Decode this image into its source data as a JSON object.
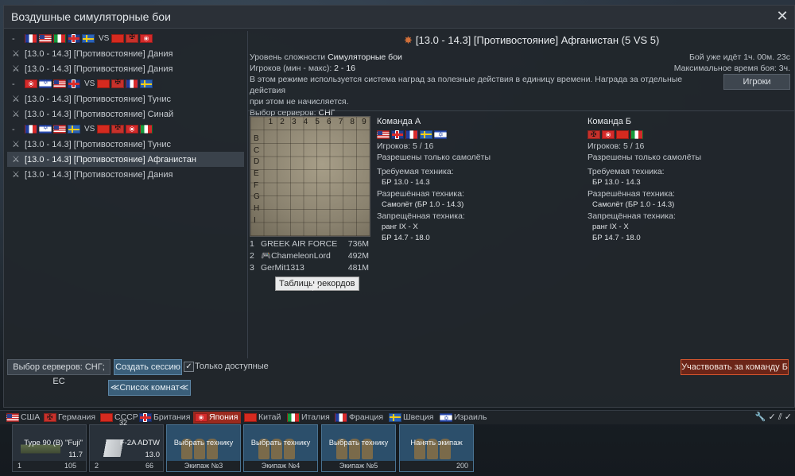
{
  "window": {
    "title": "Воздушные симуляторные бои"
  },
  "sessions": [
    {
      "kind": "header",
      "icon": "-",
      "flags_a": [
        "fr",
        "us",
        "it",
        "uk",
        "se"
      ],
      "vs": "VS",
      "flags_b": [
        "cn",
        "de",
        "jp"
      ]
    },
    {
      "kind": "mission",
      "label": "[13.0 - 14.3] [Противостояние] Дания",
      "selected": false
    },
    {
      "kind": "mission",
      "label": "[13.0 - 14.3] [Противостояние] Дания",
      "selected": false
    },
    {
      "kind": "header",
      "icon": "-",
      "flags_a": [
        "jp",
        "il",
        "us",
        "uk"
      ],
      "vs": "VS",
      "flags_b": [
        "cn",
        "de",
        "fr",
        "se"
      ]
    },
    {
      "kind": "mission",
      "label": "[13.0 - 14.3] [Противостояние] Тунис",
      "selected": false
    },
    {
      "kind": "mission",
      "label": "[13.0 - 14.3] [Противостояние] Синай",
      "selected": false
    },
    {
      "kind": "header",
      "icon": "-",
      "flags_a": [
        "fr",
        "il",
        "us",
        "se"
      ],
      "vs": "VS",
      "flags_b": [
        "cn",
        "de",
        "jp",
        "it"
      ]
    },
    {
      "kind": "mission",
      "label": "[13.0 - 14.3] [Противостояние] Тунис",
      "selected": false
    },
    {
      "kind": "mission",
      "label": "[13.0 - 14.3] [Противостояние] Афганистан",
      "selected": true
    },
    {
      "kind": "mission",
      "label": "[13.0 - 14.3] [Противостояние] Дания",
      "selected": false
    }
  ],
  "mission": {
    "title": "[13.0 - 14.3] [Противостояние] Афганистан (5 VS 5)",
    "difficulty_label": "Уровень сложности",
    "difficulty_value": "Симуляторные бои",
    "players_label": "Игроков (мин - макс):",
    "players_value": "2 - 16",
    "reward_text_1": "В этом режиме используется система наград за полезные действия в единицу времени. Награда за отдельные действия",
    "reward_text_2": "при этом не начисляется.",
    "server_label": "Выбор серверов:",
    "server_value": "СНГ",
    "battle_time": "Бой уже идёт 1ч. 00м. 23с",
    "max_time": "Максимальное время боя: 3ч.",
    "players_button": "Игроки"
  },
  "map": {
    "cols": [
      "1",
      "2",
      "3",
      "4",
      "5",
      "6",
      "7",
      "8",
      "9"
    ],
    "rows": [
      "B",
      "C",
      "D",
      "E",
      "F",
      "G",
      "H",
      "I"
    ]
  },
  "records": [
    {
      "n": "1",
      "name": "GREEK AIR FORCE",
      "score": "736M"
    },
    {
      "n": "2",
      "name": "🎮ChameleonLord",
      "score": "492M"
    },
    {
      "n": "3",
      "name": "GerMit1313",
      "score": "481M"
    }
  ],
  "tooltip": "Таблицы рекордов",
  "teamA": {
    "title": "Команда А",
    "flags": [
      "us",
      "uk",
      "fr",
      "se",
      "il"
    ],
    "players": "Игроков: 5 / 16",
    "only": "Разрешены только самолёты",
    "req_label": "Требуемая техника:",
    "req": [
      "БР 13.0 - 14.3"
    ],
    "allowed_label": "Разрешённая техника:",
    "allowed": [
      "Самолёт (БР 1.0 - 14.3)"
    ],
    "forbidden_label": "Запрещённая техника:",
    "forbidden": [
      "ранг IX - X",
      "БР 14.7 - 18.0"
    ]
  },
  "teamB": {
    "title": "Команда Б",
    "flags": [
      "de",
      "jp",
      "cn",
      "it"
    ],
    "players": "Игроков: 5 / 16",
    "only": "Разрешены только самолёты",
    "req_label": "Требуемая техника:",
    "req": [
      "БР 13.0 - 14.3"
    ],
    "allowed_label": "Разрешённая техника:",
    "allowed": [
      "Самолёт (БР 1.0 - 14.3)"
    ],
    "forbidden_label": "Запрещённая техника:",
    "forbidden": [
      "ранг IX - X",
      "БР 14.7 - 18.0"
    ]
  },
  "bottom": {
    "servers": "Выбор серверов: СНГ; ЕС",
    "create": "Создать сессию",
    "only_available": "Только доступные",
    "room_list": "≪Список комнат≪",
    "join": "Участвовать за команду Б"
  },
  "nations": [
    {
      "flag": "us",
      "label": "США",
      "active": false
    },
    {
      "flag": "de",
      "label": "Германия",
      "active": false
    },
    {
      "flag": "cn",
      "label": "СССР",
      "active": false
    },
    {
      "flag": "uk",
      "label": "Британия",
      "active": false
    },
    {
      "flag": "jp",
      "label": "Япония",
      "active": true
    },
    {
      "flag": "cn",
      "label": "Китай",
      "active": false
    },
    {
      "flag": "it",
      "label": "Италия",
      "active": false
    },
    {
      "flag": "fr",
      "label": "Франция",
      "active": false
    },
    {
      "flag": "se",
      "label": "Швеция",
      "active": false
    },
    {
      "flag": "il",
      "label": "Израиль",
      "active": false
    }
  ],
  "slots": [
    {
      "type": "vehicle",
      "name": "Type 90 (B) \"Fuji\"",
      "br": "11.7",
      "crew_no": "1",
      "count": "105"
    },
    {
      "type": "vehicle",
      "name": "F-2A ADTW",
      "br": "13.0",
      "crew_no": "2",
      "count": "66",
      "badge": "32"
    },
    {
      "type": "crew",
      "name": "Выбрать технику",
      "foot": "Экипаж №3"
    },
    {
      "type": "crew",
      "name": "Выбрать технику",
      "foot": "Экипаж №4"
    },
    {
      "type": "crew",
      "name": "Выбрать технику",
      "foot": "Экипаж №5"
    },
    {
      "type": "hire",
      "name": "Нанять экипаж",
      "cost": "200"
    }
  ]
}
